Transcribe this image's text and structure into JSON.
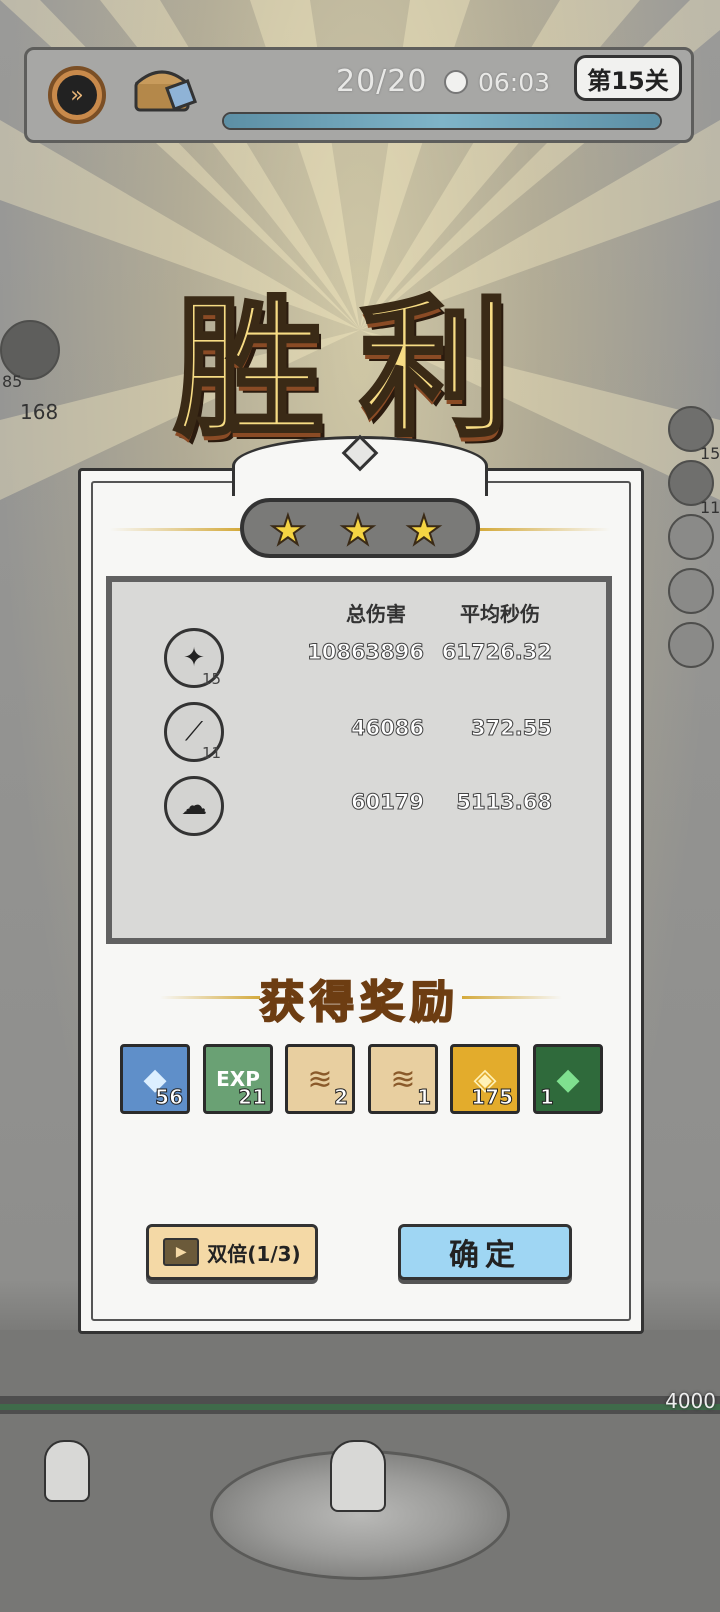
{
  "hud": {
    "speed_icon": "fast-forward-icon",
    "chest_icon": "treasure-chest-icon",
    "wave": "20/20",
    "clock_icon": "clock-icon",
    "timer": "06:03",
    "level": "第15关",
    "progress_fraction": 1.0
  },
  "banner": {
    "title": "胜利"
  },
  "result": {
    "stars": 3,
    "columns": {
      "total_damage": "总伤害",
      "avg_dps": "平均秒伤"
    },
    "skills": [
      {
        "icon": "shadow-shards-skill-icon",
        "glyph": "✦",
        "level": "15",
        "total": "10863896",
        "dps": "61726.32"
      },
      {
        "icon": "slash-skill-icon",
        "glyph": "⟋",
        "level": "11",
        "total": "46086",
        "dps": "372.55"
      },
      {
        "icon": "spirit-skill-icon",
        "glyph": "☁",
        "level": "",
        "total": "60179",
        "dps": "5113.68"
      }
    ]
  },
  "rewards": {
    "title": "获得奖励",
    "items": [
      {
        "icon": "blue-crystal-icon",
        "glyph": "◆",
        "count": "56",
        "bg": "#5f8fc9"
      },
      {
        "icon": "exp-token-icon",
        "glyph": "EXP",
        "count": "21",
        "bg": "#6aa174"
      },
      {
        "icon": "scroll-icon",
        "glyph": "📜",
        "count": "2",
        "bg": "#e8cfa0"
      },
      {
        "icon": "scroll-icon",
        "glyph": "📜",
        "count": "1",
        "bg": "#e8cfa0"
      },
      {
        "icon": "gold-coin-icon",
        "glyph": "◈",
        "count": "175",
        "bg": "#e3ac2c"
      },
      {
        "icon": "green-gem-icon",
        "glyph": "◆",
        "count": "1",
        "bg": "#2f6a3b"
      }
    ]
  },
  "buttons": {
    "double": "双倍(1/3)",
    "confirm": "确定"
  },
  "side": {
    "left_counts": [
      "85",
      "168"
    ],
    "right_counts": [
      "15",
      "11"
    ]
  },
  "wall_value": "4000"
}
